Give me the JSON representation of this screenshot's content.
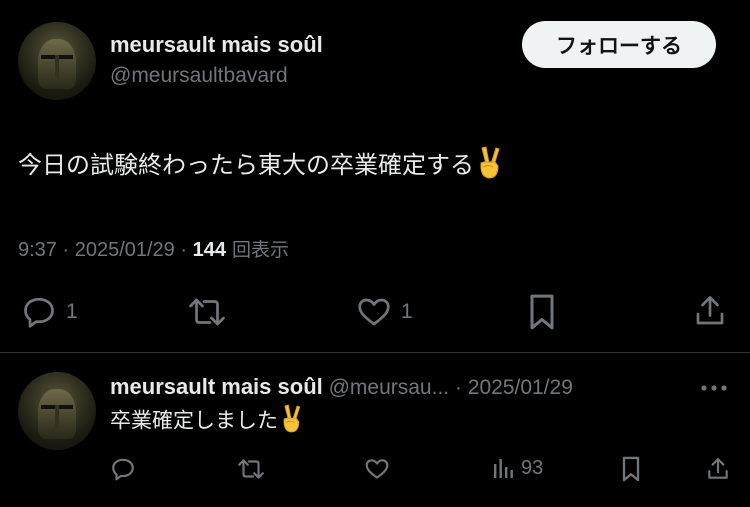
{
  "main_tweet": {
    "author_name": "meursault mais soûl",
    "handle": "@meursaultbavard",
    "follow_label": "フォローする",
    "text": "今日の試験終わったら東大の卒業確定する",
    "emoji": "✌️",
    "time": "9:37 · 2025/01/29 · ",
    "views_count": "144",
    "views_label": " 回表示",
    "actions": {
      "reply_count": "1",
      "like_count": "1"
    }
  },
  "reply_tweet": {
    "author_name": "meursault mais soûl",
    "handle_date": " @meursau... · 2025/01/29",
    "text": "卒業確定しました",
    "emoji": "✌️",
    "views_count": "93"
  },
  "icons": [
    "reply-icon",
    "retweet-icon",
    "like-icon",
    "bookmark-icon",
    "share-icon",
    "more-icon",
    "views-icon"
  ]
}
